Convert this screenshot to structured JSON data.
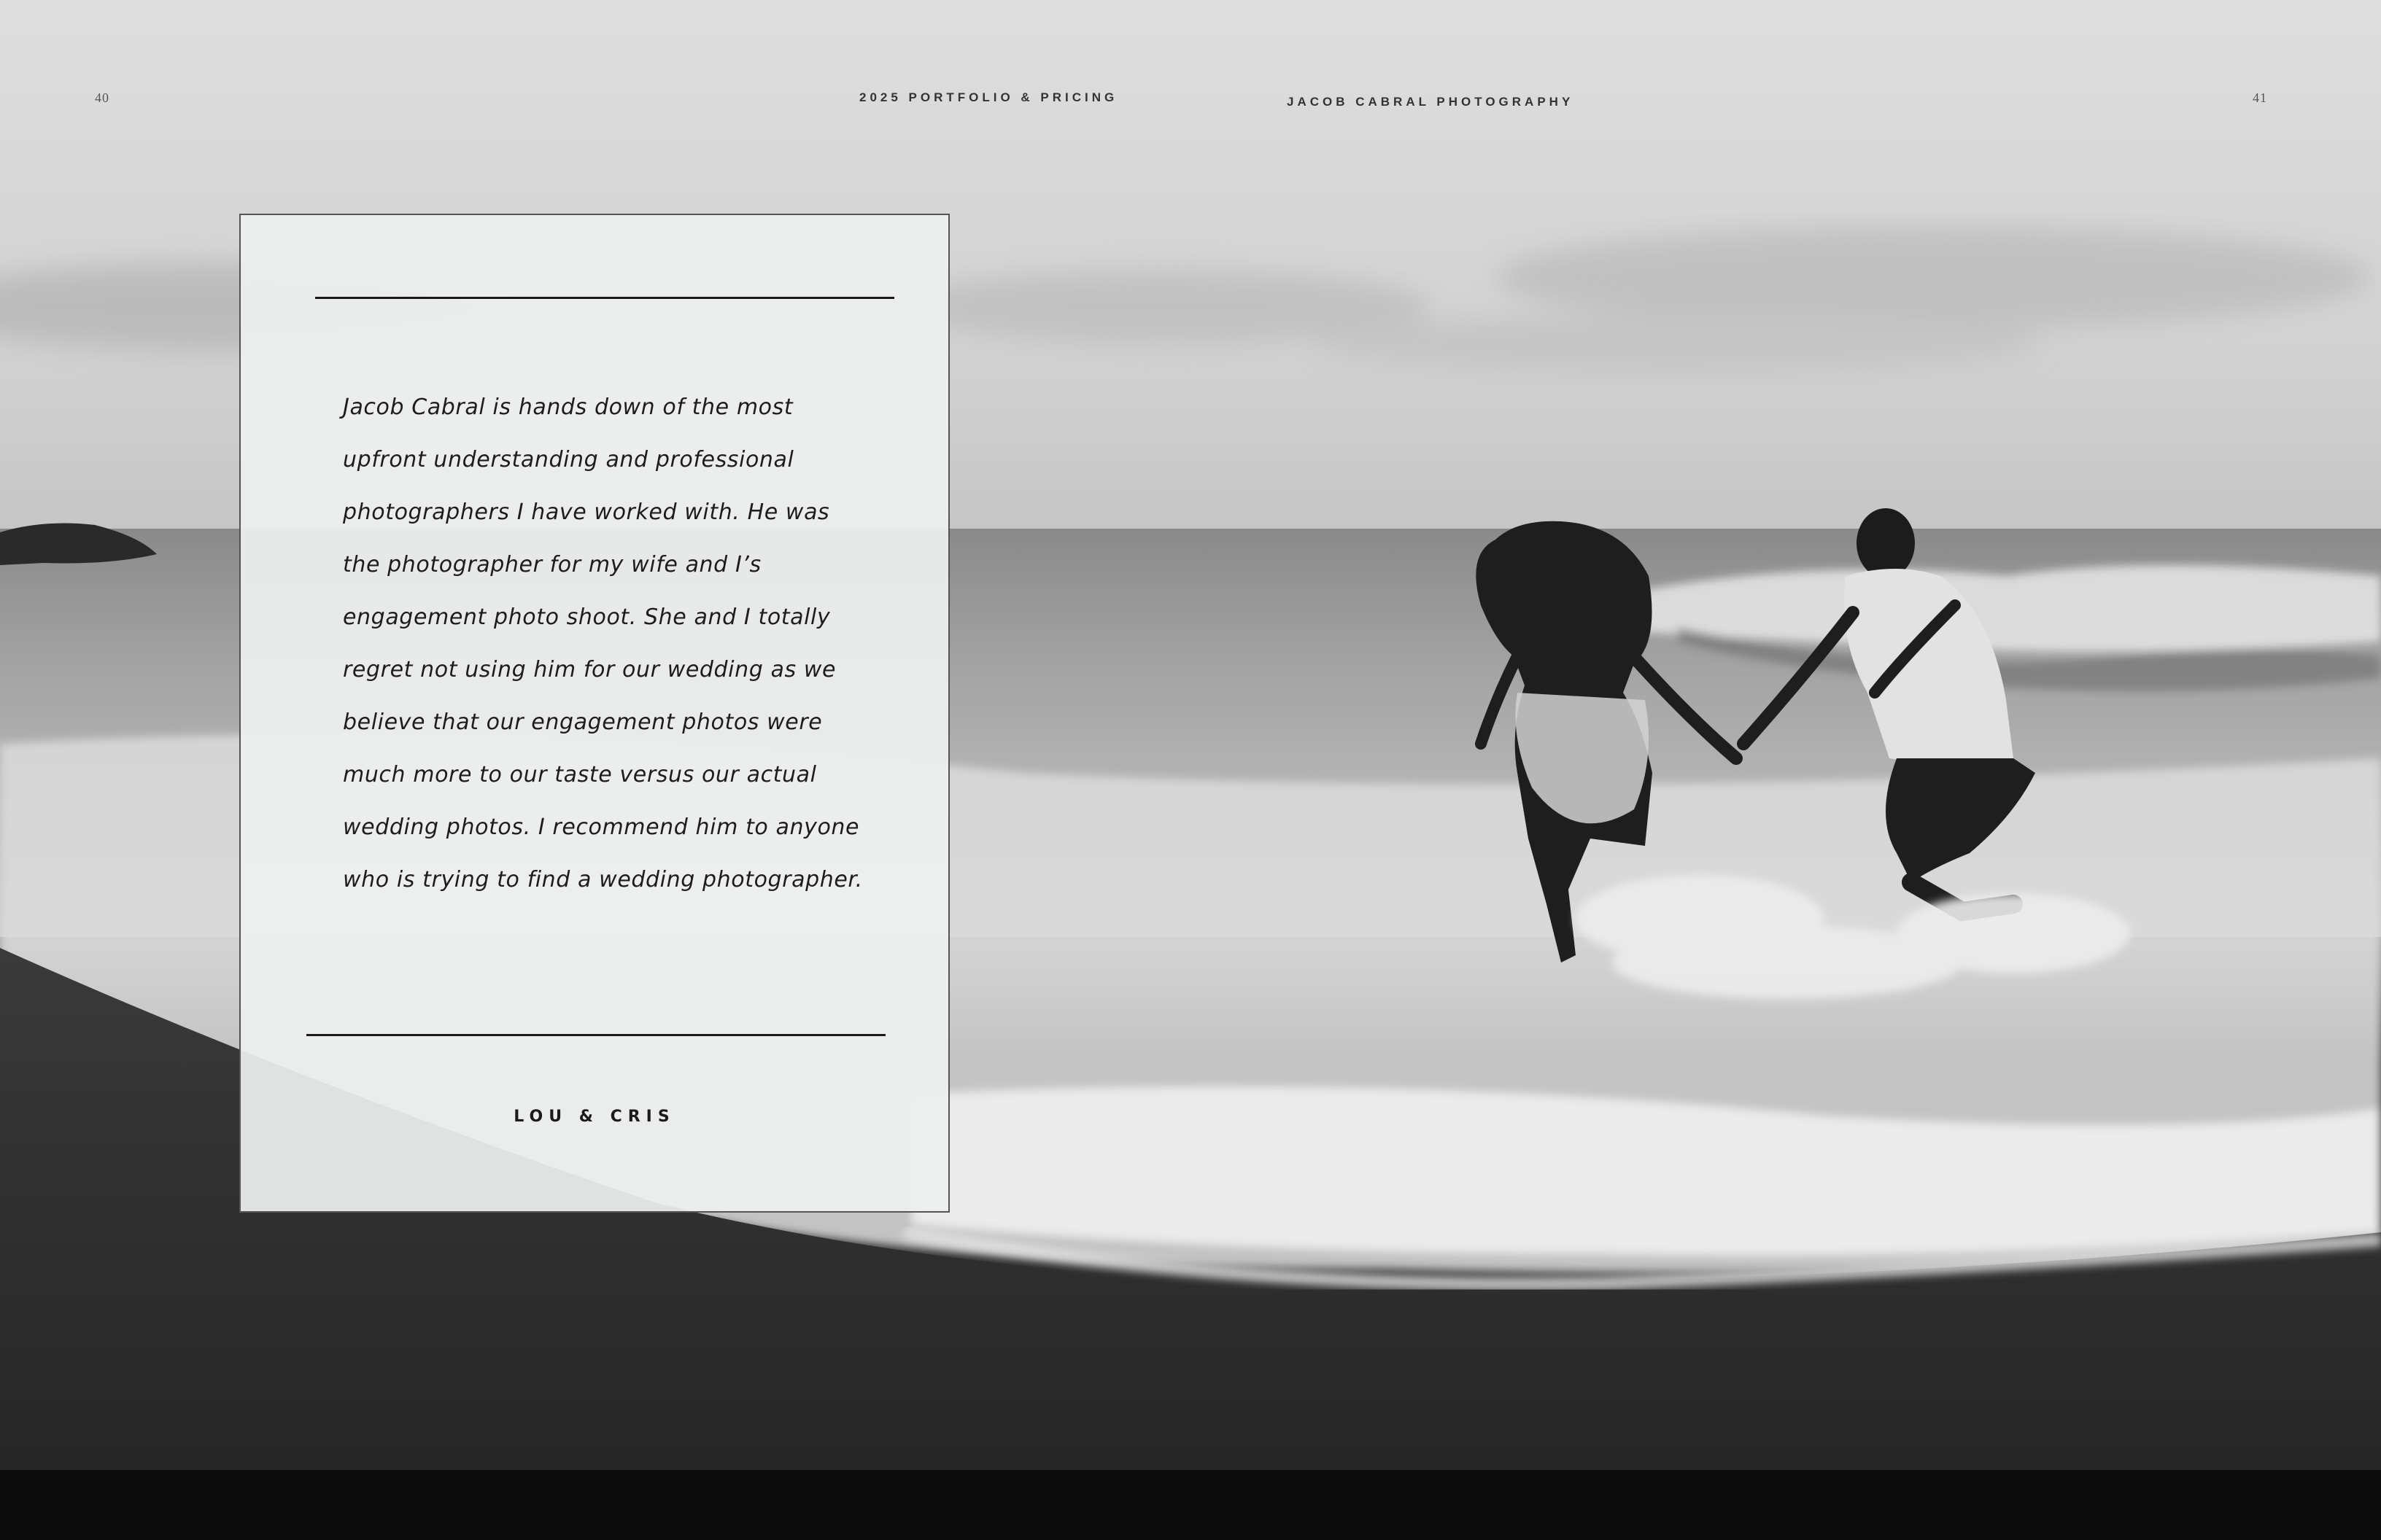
{
  "header": {
    "left_page_number": "40",
    "right_page_number": "41",
    "left_running_head": "2025 PORTFOLIO & PRICING",
    "right_running_head": "JACOB CABRAL PHOTOGRAPHY"
  },
  "testimonial": {
    "quote": "Jacob Cabral is hands down of the most upfront understanding and professional photographers I have worked with. He was the photographer for my wife and I’s engagement photo shoot. She and I totally regret not using him for our wedding as we believe that our engagement photos were much more to our taste versus our actual wedding photos. I recommend him to anyone who is trying to find a wedding photographer.",
    "author": "LOU & CRIS"
  },
  "photo": {
    "subject": "couple-running-in-surf-icon",
    "palette": {
      "sky": "#d8d8d8",
      "sea": "#8c8c8c",
      "foam": "#e6e6e6",
      "sand": "#2b2b2b"
    }
  }
}
